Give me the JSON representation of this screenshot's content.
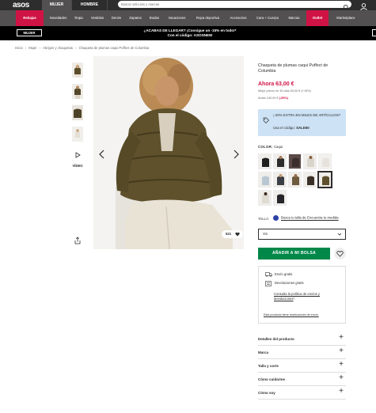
{
  "header": {
    "logo": "asos",
    "gender_tabs": [
      "MUJER",
      "HOMBRE"
    ],
    "search_placeholder": "Buscar artículos y marcas"
  },
  "categories": [
    "Rebajas",
    "Novedades",
    "Ropa",
    "Vestidos",
    "Denim",
    "Zapatos",
    "Bodas",
    "Vacaciones",
    "Ropa deportiva",
    "Accesorios",
    "Cara + Cuerpo",
    "Marcas",
    "Outlet",
    "Marketplace"
  ],
  "promo": {
    "mujer": "MUJER",
    "line1": "¿ACABAS DE LLEGAR? ¡Consigue un -15% en todo!*",
    "line2": "Con el código: ASOSNEW"
  },
  "breadcrumb": [
    "Inicio",
    "Mujer",
    "Abrigos y chaquetas",
    "Chaqueta de plumas caqui Puffect de Columbia"
  ],
  "gallery": {
    "video_label": "VÍDEO",
    "saves": "521"
  },
  "product": {
    "title": "Chaqueta de plumas caqui Puffect de Columbia",
    "price": "Ahora 63,00 €",
    "price_note": "Mejor precio en 30 días 53,00 € (+19%)",
    "price_note2_prefix": "Antes 140,00 €",
    "price_note2_discount": "(-55%)",
    "promo_line1": "¡-20% EXTRA EN MILES DE ARTÍCULOS!*",
    "promo_line2_prefix": "Usa el código:",
    "promo_code": "SALE50",
    "color_label": "COLOR:",
    "color_value": "Caqui",
    "size_label": "TALLA:",
    "size_guide": "Busca tu talla de Encuentra tu medida",
    "size_selected": "XS",
    "add_to_bag": "AÑADIR A MI BOLSA",
    "delivery_free": "Envío gratis.",
    "returns_free": "Devoluciones gratis",
    "policy_link": "Consulta la política de envíos y devoluciones",
    "policy_suffix": "*.",
    "restriction_note": "Este producto tiene restricciones de envío."
  },
  "accordion": [
    "Detalles del producto",
    "Marca",
    "Talla y corte",
    "Cómo cuidarme",
    "Cómo soy"
  ],
  "colors": {
    "brand_dark": "#2d2d2d",
    "accent_red": "#d01345",
    "add_bag_green": "#018849",
    "promo_blue": "#cde2f5"
  }
}
